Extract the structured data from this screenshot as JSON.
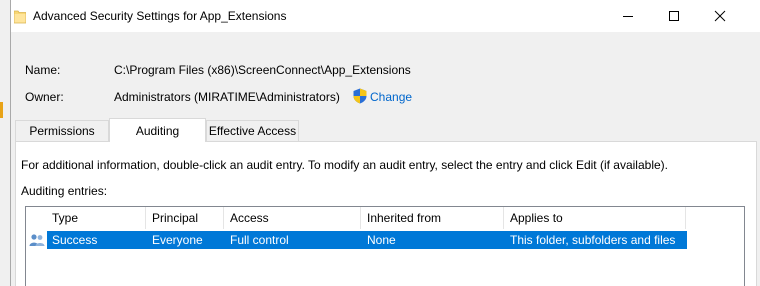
{
  "window": {
    "title": "Advanced Security Settings for App_Extensions",
    "controls": {
      "minimize": "minimize",
      "maximize": "maximize",
      "close": "close"
    }
  },
  "fields": {
    "name_label": "Name:",
    "name_value": "C:\\Program Files (x86)\\ScreenConnect\\App_Extensions",
    "owner_label": "Owner:",
    "owner_value": "Administrators (MIRATIME\\Administrators)",
    "change_link": "Change"
  },
  "tabs": [
    {
      "label": "Permissions",
      "active": false
    },
    {
      "label": "Auditing",
      "active": true
    },
    {
      "label": "Effective Access",
      "active": false
    }
  ],
  "auditing": {
    "info_text": "For additional information, double-click an audit entry. To modify an audit entry, select the entry and click Edit (if available).",
    "entries_label": "Auditing entries:",
    "columns": [
      "Type",
      "Principal",
      "Access",
      "Inherited from",
      "Applies to"
    ],
    "rows": [
      {
        "type": "Success",
        "principal": "Everyone",
        "access": "Full control",
        "inherited_from": "None",
        "applies_to": "This folder, subfolders and files",
        "selected": true,
        "icon": "users-icon"
      }
    ]
  },
  "colors": {
    "selection": "#0078d7",
    "link": "#0066cc",
    "window_bg": "#f0f0f0"
  }
}
